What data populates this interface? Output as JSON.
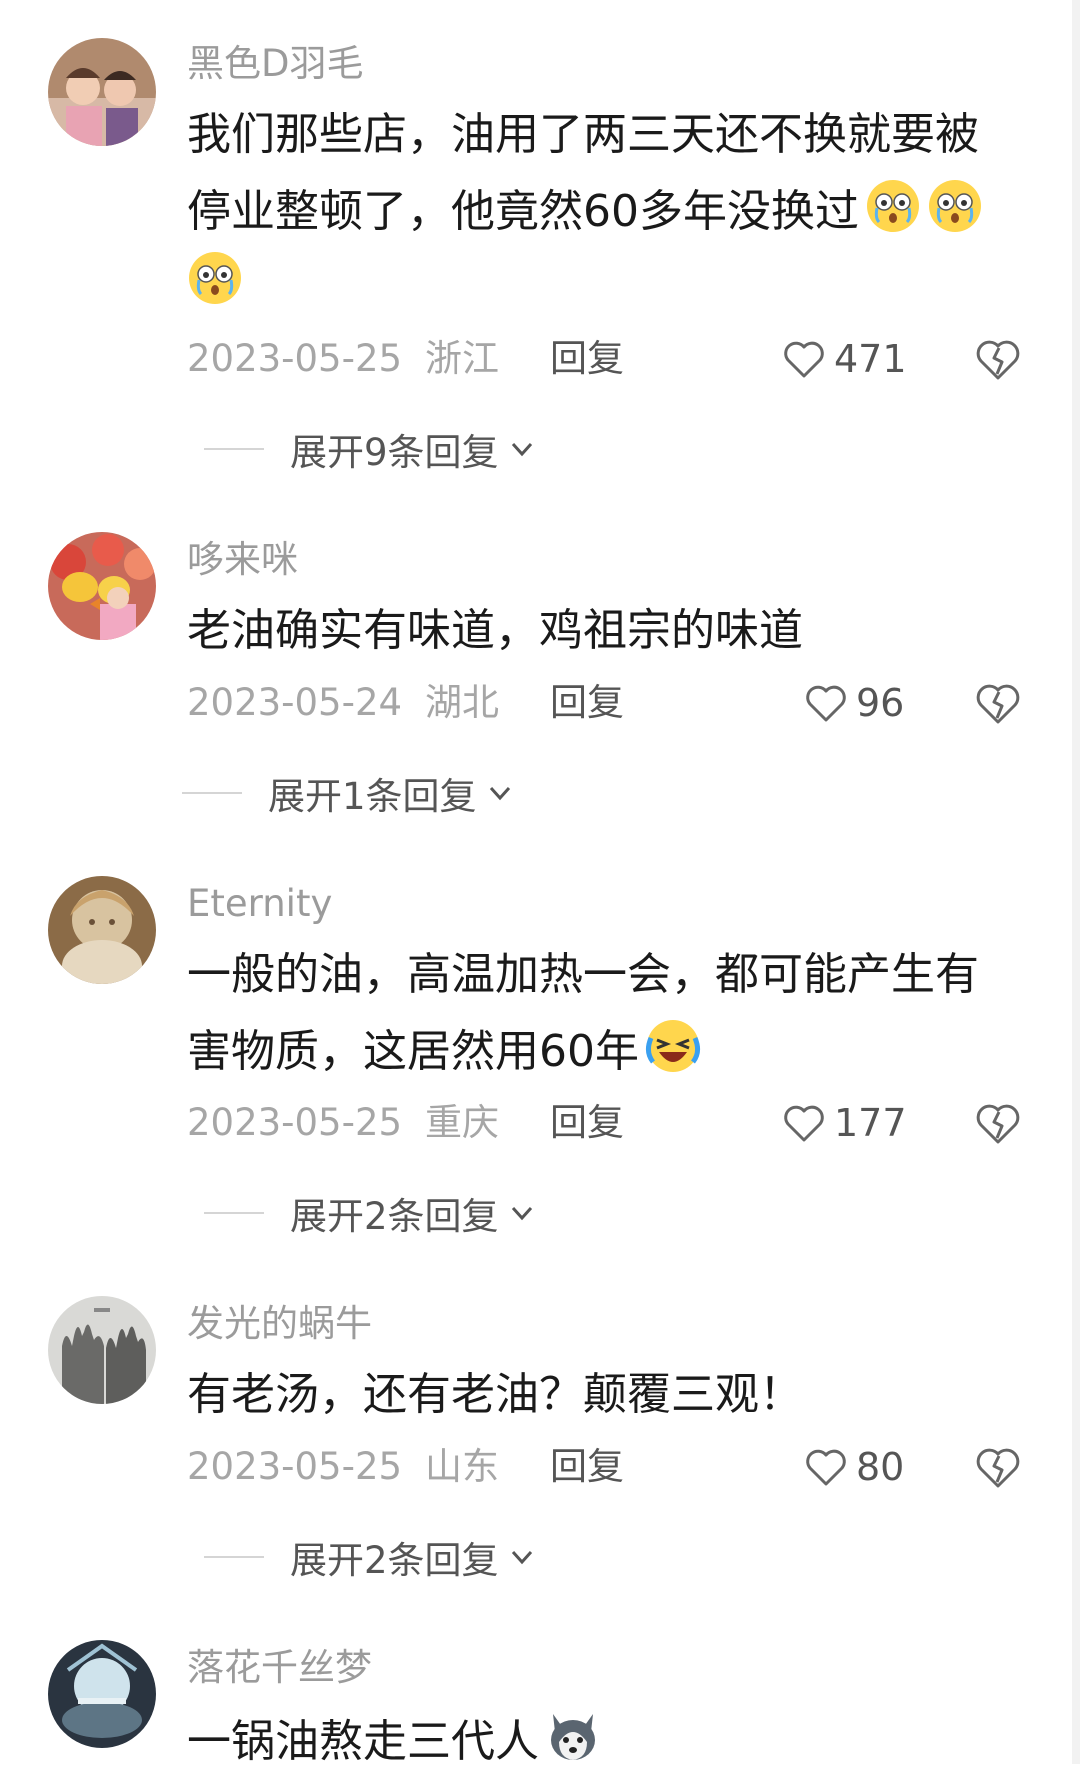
{
  "comments": [
    {
      "username": "黑色D羽毛",
      "lines": [
        "我们那些店，油用了两三天还不换就要被",
        "停业整顿了，他竟然60多年没换过"
      ],
      "emojis": [
        "astonished-cry-emoji",
        "astonished-cry-emoji",
        "astonished-cry-emoji"
      ],
      "date": "2023-05-25",
      "region": "浙江",
      "reply_label": "回复",
      "likes": "471",
      "expand_label": "展开9条回复"
    },
    {
      "username": "哆来咪",
      "lines": [
        "老油确实有味道，鸡祖宗的味道"
      ],
      "emojis": [],
      "date": "2023-05-24",
      "region": "湖北",
      "reply_label": "回复",
      "likes": "96",
      "expand_label": "展开1条回复"
    },
    {
      "username": "Eternity",
      "lines": [
        "一般的油，高温加热一会，都可能产生有",
        "害物质，这居然用60年"
      ],
      "emojis": [
        "laugh-cry-emoji"
      ],
      "date": "2023-05-25",
      "region": "重庆",
      "reply_label": "回复",
      "likes": "177",
      "expand_label": "展开2条回复"
    },
    {
      "username": "发光的蜗牛",
      "lines": [
        "有老汤，还有老油？颠覆三观！"
      ],
      "emojis": [],
      "date": "2023-05-25",
      "region": "山东",
      "reply_label": "回复",
      "likes": "80",
      "expand_label": "展开2条回复"
    },
    {
      "username": "落花千丝梦",
      "lines": [
        "一锅油熬走三代人"
      ],
      "emojis": [
        "husky-emoji"
      ]
    }
  ],
  "colors": {
    "username": "#9b9b9b",
    "text": "#1a1a1a",
    "meta": "#a6a6a6",
    "action": "#555555"
  }
}
